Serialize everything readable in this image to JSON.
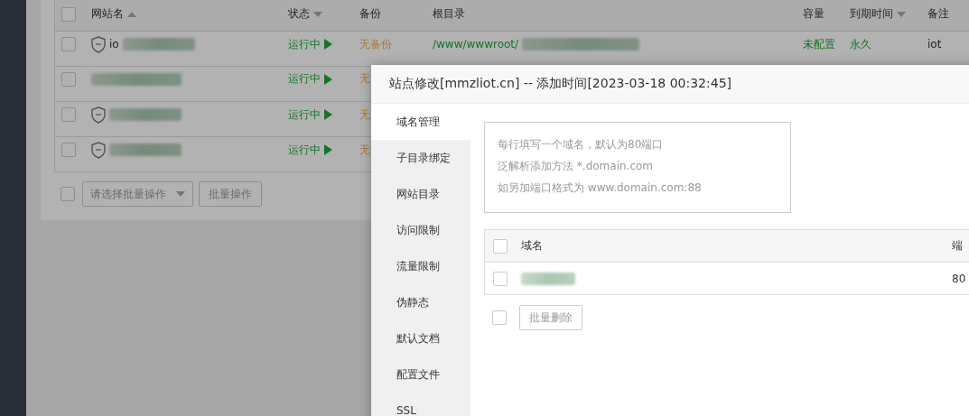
{
  "site_table": {
    "header_checked": false,
    "columns": [
      {
        "label": "网站名",
        "sorted": true,
        "ascending": true
      },
      {
        "label": "状态",
        "sorted": true,
        "ascending": false
      },
      {
        "label": "备份",
        "sorted": false
      },
      {
        "label": "根目录",
        "sorted": false
      },
      {
        "label": "容量",
        "sorted": false
      },
      {
        "label": "到期时间",
        "sorted": true,
        "ascending": false
      },
      {
        "label": "备注",
        "sorted": false
      }
    ],
    "rows": [
      {
        "checked": false,
        "waf": true,
        "name": "io",
        "status": "运行中",
        "backup": "无备份",
        "root": "/www/wwwroot/",
        "capacity": "未配置",
        "expiry": "永久",
        "remark": "iot"
      },
      {
        "checked": false,
        "waf": false,
        "status": "运行中",
        "backup": "无"
      },
      {
        "checked": false,
        "waf": true,
        "status": "运行中",
        "backup": "无"
      },
      {
        "checked": false,
        "waf": true,
        "status": "运行中",
        "backup": "无"
      }
    ],
    "footer": {
      "checked": false,
      "batch_select": {
        "placeholder": "请选择批量操作"
      },
      "batch_button": "批量操作"
    }
  },
  "dialog": {
    "title": "站点修改[mmzliot.cn] -- 添加时间[2023-03-18 00:32:45]",
    "menu": [
      {
        "label": "域名管理",
        "selected": true
      },
      {
        "label": "子目录绑定",
        "selected": false
      },
      {
        "label": "网站目录",
        "selected": false
      },
      {
        "label": "访问限制",
        "selected": false
      },
      {
        "label": "流量限制",
        "selected": false
      },
      {
        "label": "伪静态",
        "selected": false
      },
      {
        "label": "默认文档",
        "selected": false
      },
      {
        "label": "配置文件",
        "selected": false
      },
      {
        "label": "SSL",
        "selected": false
      }
    ],
    "domain_input": {
      "placeholder_lines": [
        "每行填写一个域名，默认为80端口",
        "泛解析添加方法 *.domain.com",
        "如另加端口格式为 www.domain.com:88"
      ]
    },
    "domain_table": {
      "header_checked": false,
      "columns": [
        "域名",
        "端"
      ],
      "rows": [
        {
          "checked": false,
          "port": "80"
        }
      ]
    },
    "footer": {
      "checked": false,
      "delete_button": "批量删除"
    }
  }
}
